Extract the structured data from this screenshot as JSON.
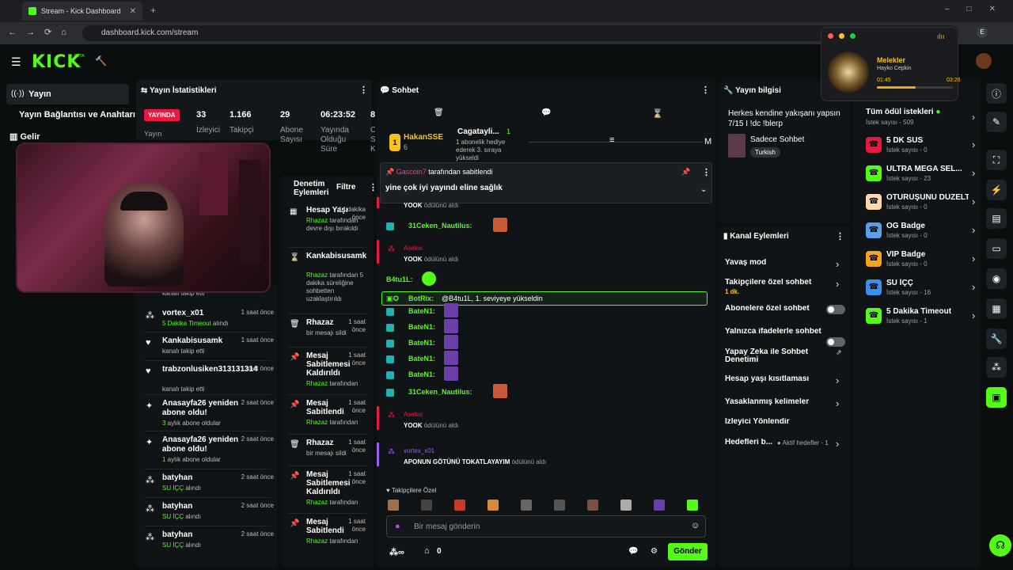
{
  "browser": {
    "tab_title": "Stream - Kick Dashboard",
    "url": "dashboard.kick.com/stream",
    "profile": "E"
  },
  "topnav": {
    "logo": "KICK",
    "beta": "BETA"
  },
  "sidebar": {
    "items": [
      {
        "label": "Yayın"
      },
      {
        "label": "Yayın Bağlantısı ve Anahtarı"
      },
      {
        "label": "Gelir"
      }
    ]
  },
  "stats": {
    "title": "Yayın İstatistikleri",
    "live": "YAYINDA",
    "live_sub": "Yayın",
    "cols": [
      {
        "value": "33",
        "label": "İzleyici"
      },
      {
        "value": "1.166",
        "label": "Takipçi"
      },
      {
        "value": "29",
        "label": "Abone Sayısı"
      },
      {
        "value": "06:23:52",
        "label": "Yayında Olduğu Süre"
      },
      {
        "value": "8",
        "label": "C S K"
      }
    ]
  },
  "activity": [
    {
      "meta": "kanalı takip etti",
      "name": "",
      "time": ""
    },
    {
      "name": "vortex_x01",
      "meta": "5 Dakika Timeout",
      "meta2": "alındı",
      "time": "1 saat önce"
    },
    {
      "name": "Kankabisusamk",
      "meta": "kanalı takip etti",
      "time": "1 saat önce"
    },
    {
      "name": "trabzonlusiken313131314",
      "meta": "kanalı takip etti",
      "time": "1 saat önce"
    },
    {
      "name": "Anasayfa26 yeniden abone oldu!",
      "meta": "3",
      "meta2": "aylık abone oldular",
      "time": "2 saat önce"
    },
    {
      "name": "Anasayfa26 yeniden abone oldu!",
      "meta": "1",
      "meta2": "aylık abone oldular",
      "time": "2 saat önce"
    },
    {
      "name": "batyhan",
      "meta": "SU İÇÇ",
      "meta2": "alındı",
      "time": "2 saat önce"
    },
    {
      "name": "batyhan",
      "meta": "SU İÇÇ",
      "meta2": "alındı",
      "time": "2 saat önce"
    },
    {
      "name": "batyhan",
      "meta": "SU İÇÇ",
      "meta2": "alındı",
      "time": "2 saat önce"
    }
  ],
  "moderation": {
    "title": "Denetim Eylemleri",
    "filter": "Filtre",
    "items": [
      {
        "title": "Hesap Yaşı",
        "time": "14 dakika önce",
        "by": "Rhazaz",
        "desc": "tarafından devre dışı bırakıldı"
      },
      {
        "title": "Kankabisusamk",
        "time": "",
        "by": "Rhazaz",
        "desc": "tarafından 5 dakika süreliğine sohbetten uzaklaştırıldı"
      },
      {
        "title": "Rhazaz",
        "time": "1 saat önce",
        "by": "",
        "desc": "bir mesajı sildi"
      },
      {
        "title": "Mesaj Sabitlemesi Kaldırıldı",
        "time": "1 saat önce",
        "by": "Rhazaz",
        "desc": "tarafından"
      },
      {
        "title": "Mesaj Sabitlendi",
        "time": "1 saat önce",
        "by": "Rhazaz",
        "desc": "tarafından"
      },
      {
        "title": "Rhazaz",
        "time": "1 saat önce",
        "by": "",
        "desc": "bir mesajı sildi"
      },
      {
        "title": "Mesaj Sabitlemesi Kaldırıldı",
        "time": "1 saat önce",
        "by": "Rhazaz",
        "desc": "tarafından"
      },
      {
        "title": "Mesaj Sabitlendi",
        "time": "1 saat önce",
        "by": "Rhazaz",
        "desc": "tarafından"
      }
    ]
  },
  "chat": {
    "title": "Sohbet",
    "gift_user": "HakanSSE",
    "gift_count": "6",
    "gift_user2": "Cagatayli...",
    "gift_count2": "1",
    "gift_text": "1 abonelik hediye ederek 3. sıraya yükseldi",
    "pinned_by": "Gascoin7",
    "pinned_by_suffix": "tarafından sabitlendi",
    "pinned_text": "yine çok iyi yayındı eline sağlık",
    "messages": [
      {
        "type": "reward",
        "user": "",
        "text": "YOOK",
        "suffix": "ödülünü aldı"
      },
      {
        "type": "msg",
        "user": "31Ceken_Nautilus:",
        "text": ""
      },
      {
        "type": "reward",
        "user": "Aselos",
        "text": "YOOK",
        "suffix": "ödülünü aldı"
      },
      {
        "type": "msg",
        "user": "B4tu1L:",
        "text": ""
      },
      {
        "type": "bot",
        "user": "BotRix:",
        "text": "@B4tu1L, 1. seviyeye yükseldin"
      },
      {
        "type": "msg",
        "user": "BateN1:",
        "text": ""
      },
      {
        "type": "msg",
        "user": "BateN1:",
        "text": ""
      },
      {
        "type": "msg",
        "user": "BateN1:",
        "text": ""
      },
      {
        "type": "msg",
        "user": "BateN1:",
        "text": ""
      },
      {
        "type": "msg",
        "user": "BateN1:",
        "text": ""
      },
      {
        "type": "msg",
        "user": "31Ceken_Nautilus:",
        "text": ""
      },
      {
        "type": "reward",
        "user": "Aselos",
        "text": "YOOK",
        "suffix": "ödülünü aldı"
      },
      {
        "type": "reward",
        "user": "vortex_x01",
        "text": "APONUN GÖTÜNÜ TOKATLAYAYIM",
        "suffix": "ödülünü aldı"
      }
    ],
    "followers_only": "Takipçilere Özel",
    "input_placeholder": "Bir mesaj gönderin",
    "points": "0",
    "send": "Gönder"
  },
  "stream_info": {
    "title": "Yayın bilgisi",
    "stream_title": "Herkes kendine yakışanı yapsın 7/15 I !dc !blerp",
    "category": "Sadece Sohbet",
    "tag": "Turkish"
  },
  "channel": {
    "title": "Kanal Eylemleri",
    "items": [
      {
        "label": "Yavaş mod",
        "sub": "",
        "kind": "chev"
      },
      {
        "label": "Takipçilere özel sohbet",
        "sub": "1 dk.",
        "kind": "chev"
      },
      {
        "label": "Abonelere özel sohbet",
        "sub": "",
        "kind": "toggle"
      },
      {
        "label": "Yalnızca ifadelerle sohbet",
        "sub": "",
        "kind": "toggle"
      },
      {
        "label": "Yapay Zeka ile Sohbet Denetimi",
        "sub": "",
        "kind": "ext"
      },
      {
        "label": "Hesap yaşı kısıtlaması",
        "sub": "",
        "kind": "chev"
      },
      {
        "label": "Yasaklanmış kelimeler",
        "sub": "",
        "kind": "chev"
      },
      {
        "label": "İzleyici Yönlendir",
        "sub": "",
        "kind": "none"
      },
      {
        "label": "Hedefleri b...",
        "sub": "Aktif hedefler - 1",
        "kind": "chev"
      }
    ]
  },
  "rewards": {
    "title": "Tüm ödül istekleri",
    "count": "İstek sayısı - 509",
    "items": [
      {
        "name": "5 DK SUS",
        "count": "İstek sayısı - 0",
        "color": "#e9193f"
      },
      {
        "name": "ULTRA MEGA SEL...",
        "count": "İstek sayısı - 23",
        "color": "#53fc18"
      },
      {
        "name": "OTURUŞUNU DÜZELT",
        "count": "İstek sayısı - 0",
        "color": "#ffd9a8"
      },
      {
        "name": "OG Badge",
        "count": "İstek sayısı - 0",
        "color": "#5b9ee9"
      },
      {
        "name": "VIP Badge",
        "count": "İstek sayısı - 0",
        "color": "#f6a21b"
      },
      {
        "name": "SU İÇÇ",
        "count": "İstek sayısı - 16",
        "color": "#3b8ee9"
      },
      {
        "name": "5 Dakika Timeout",
        "count": "İstek sayısı - 1",
        "color": "#53fc18"
      }
    ]
  },
  "music": {
    "title": "Melekler",
    "artist": "Hayko Cepkin",
    "elapsed": "01:45",
    "total": "03:26",
    "progress": 0.51
  }
}
